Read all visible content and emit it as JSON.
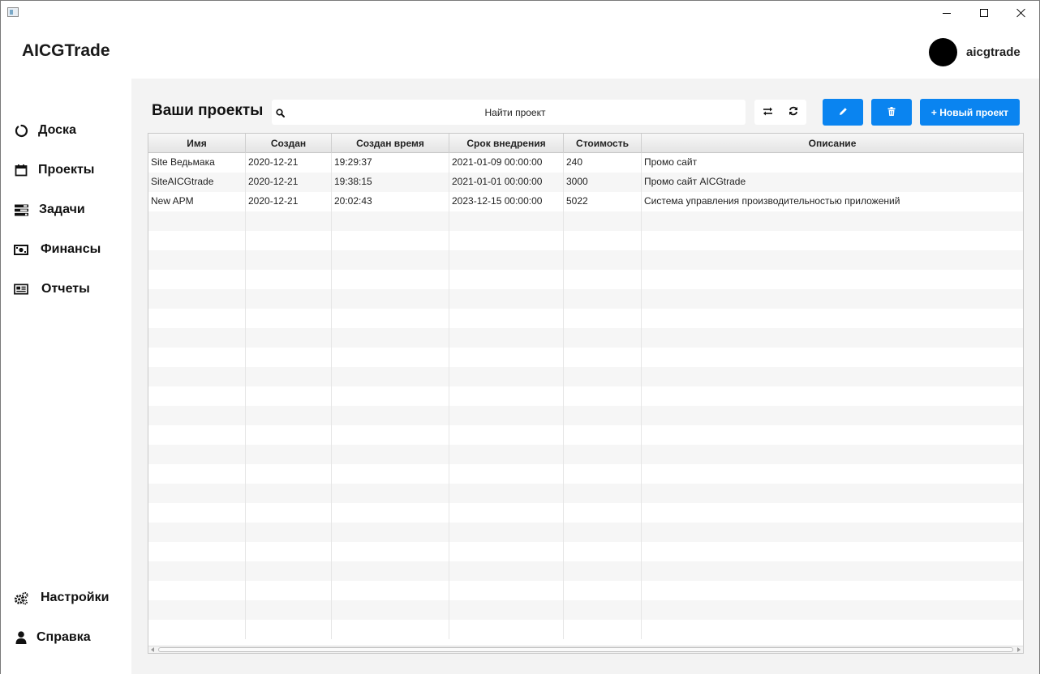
{
  "app": {
    "title": "AICGTrade",
    "username": "aicgtrade"
  },
  "nav": {
    "top": [
      {
        "label": "Доска",
        "icon": "circle-notch-icon"
      },
      {
        "label": "Проекты",
        "icon": "calendar-icon"
      },
      {
        "label": "Задачи",
        "icon": "tasks-icon"
      },
      {
        "label": "Финансы",
        "icon": "money-bill-icon"
      },
      {
        "label": "Отчеты",
        "icon": "newspaper-icon"
      }
    ],
    "bottom": [
      {
        "label": "Настройки",
        "icon": "cogs-icon"
      },
      {
        "label": "Справка",
        "icon": "user-icon"
      }
    ]
  },
  "toolbar": {
    "title": "Ваши проекты",
    "search_placeholder": "Найти проект",
    "sort_icon": "exchange-icon",
    "refresh_icon": "refresh-icon",
    "edit_icon": "pencil-icon",
    "delete_icon": "trash-icon",
    "new_label": "+ Новый проект"
  },
  "table": {
    "columns": [
      "Имя",
      "Создан",
      "Создан время",
      "Срок внедрения",
      "Стоимость",
      "Описание"
    ],
    "rows": [
      [
        "Site Ведьмака",
        "2020-12-21",
        "19:29:37",
        "2021-01-09 00:00:00",
        "240",
        "Промо сайт"
      ],
      [
        "SiteAICGtrade",
        "2020-12-21",
        "19:38:15",
        "2021-01-01 00:00:00",
        "3000",
        "Промо сайт AICGtrade"
      ],
      [
        "New APM",
        "2020-12-21",
        "20:02:43",
        "2023-12-15 00:00:00",
        "5022",
        "Система управления производительностью приложений"
      ]
    ]
  },
  "colors": {
    "accent": "#0a84f0",
    "content_bg": "#f3f3f3"
  }
}
